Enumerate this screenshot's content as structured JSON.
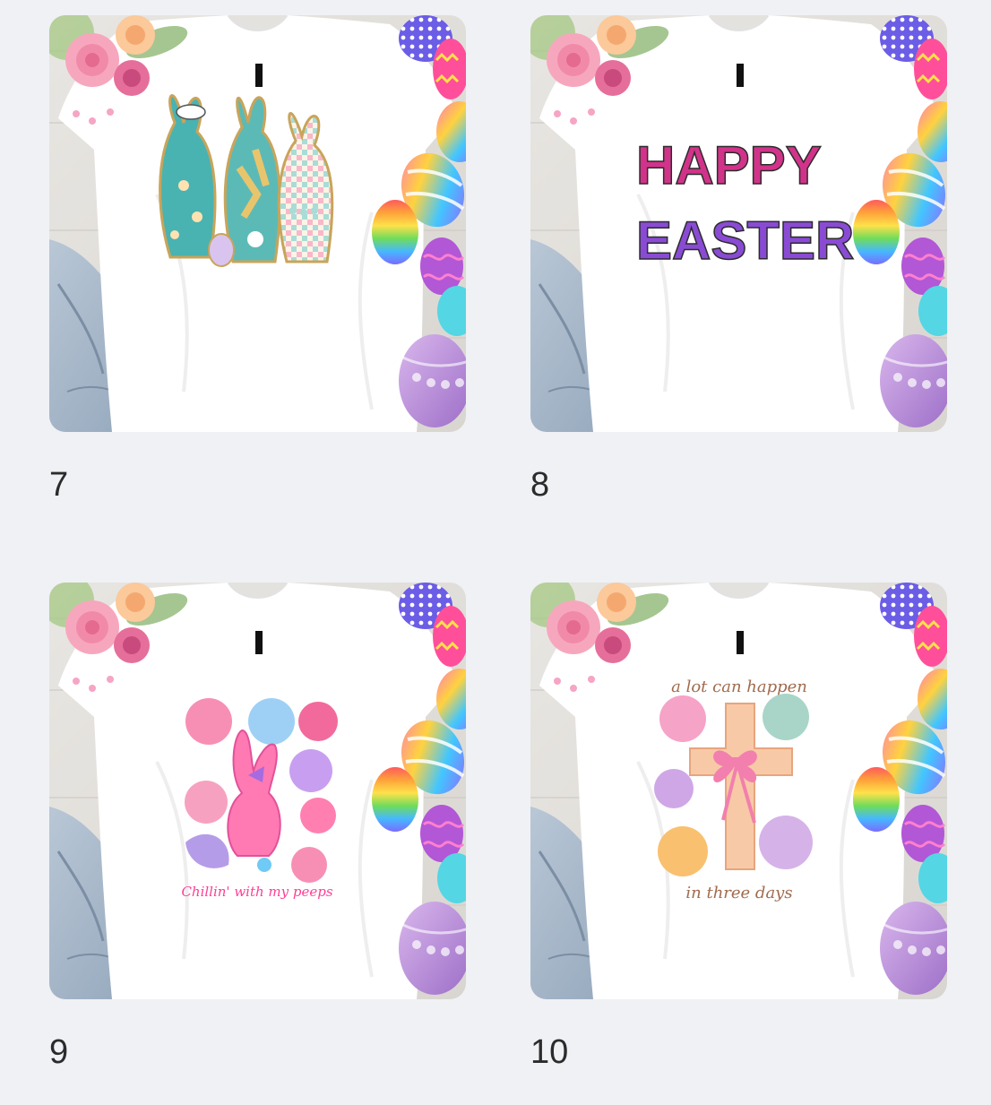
{
  "products": [
    {
      "number": "7",
      "design": "three-bunnies"
    },
    {
      "number": "8",
      "design": "happy-easter",
      "print_text": [
        "HAPPY",
        "EASTER"
      ]
    },
    {
      "number": "9",
      "design": "floral-bunny",
      "print_text": "Chillin' with my peeps"
    },
    {
      "number": "10",
      "design": "floral-cross",
      "print_text_top": "a lot can happen",
      "print_text_bottom": "in three days"
    }
  ],
  "colors": {
    "background": "#eff1f5",
    "shirt": "#ffffff",
    "label": "#2b2b2b"
  }
}
